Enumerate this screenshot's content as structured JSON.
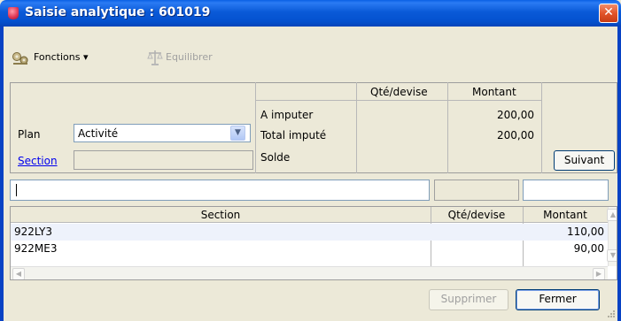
{
  "window": {
    "title": "Saisie analytique : 601019",
    "close_glyph": "✕"
  },
  "toolbar": {
    "fonctions_label": "Fonctions",
    "fonctions_arrow": "▾",
    "equilibrer_label": "Equilibrer"
  },
  "summary": {
    "col_qte": "Qté/devise",
    "col_montant": "Montant",
    "rows": [
      {
        "label": "A imputer",
        "montant": "200,00"
      },
      {
        "label": "Total imputé",
        "montant": "200,00"
      },
      {
        "label": "Solde",
        "montant": ""
      }
    ]
  },
  "form": {
    "plan_label": "Plan",
    "plan_value": "Activité",
    "section_label": "Section",
    "suivant_label": "Suivant"
  },
  "grid": {
    "headers": [
      "Section",
      "Qté/devise",
      "Montant"
    ],
    "rows": [
      {
        "section": "922LY3",
        "qte": "",
        "montant": "110,00"
      },
      {
        "section": "922ME3",
        "qte": "",
        "montant": "90,00"
      }
    ]
  },
  "footer": {
    "supprimer_label": "Supprimer",
    "fermer_label": "Fermer"
  },
  "colors": {
    "titlebar": "#0a5ad8",
    "window_bg": "#ece9d8",
    "link": "#0000ee",
    "row_selected": "#eef2fb"
  },
  "icons": {
    "app": "app-icon",
    "close": "close-icon",
    "fonctions": "gears-icon",
    "equilibrer": "scales-icon",
    "dropdown": "chevron-down-icon"
  }
}
